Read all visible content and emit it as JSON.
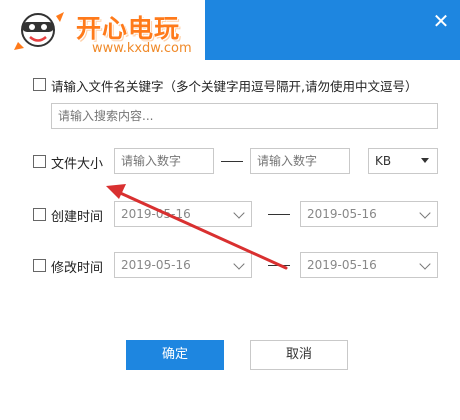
{
  "window": {
    "close_glyph": "✕",
    "brand_color": "#1e86e0"
  },
  "logo": {
    "text": "开心电玩",
    "url": "www.kxdw.com"
  },
  "keyword": {
    "label": "请输入文件名关键字（多个关键字用逗号隔开,请勿使用中文逗号）",
    "placeholder": "请输入搜索内容..."
  },
  "file_size": {
    "label": "文件大小",
    "min_placeholder": "请输入数字",
    "max_placeholder": "请输入数字",
    "separator": "—",
    "unit": "KB"
  },
  "created_time": {
    "label": "创建时间",
    "start": "2019-05-16",
    "end": "2019-05-16",
    "separator": "—"
  },
  "modified_time": {
    "label": "修改时间",
    "start": "2019-05-16",
    "end": "2019-05-16",
    "separator": "—"
  },
  "actions": {
    "ok": "确定",
    "cancel": "取消"
  },
  "annotation": {
    "arrow_color": "#d93030"
  }
}
